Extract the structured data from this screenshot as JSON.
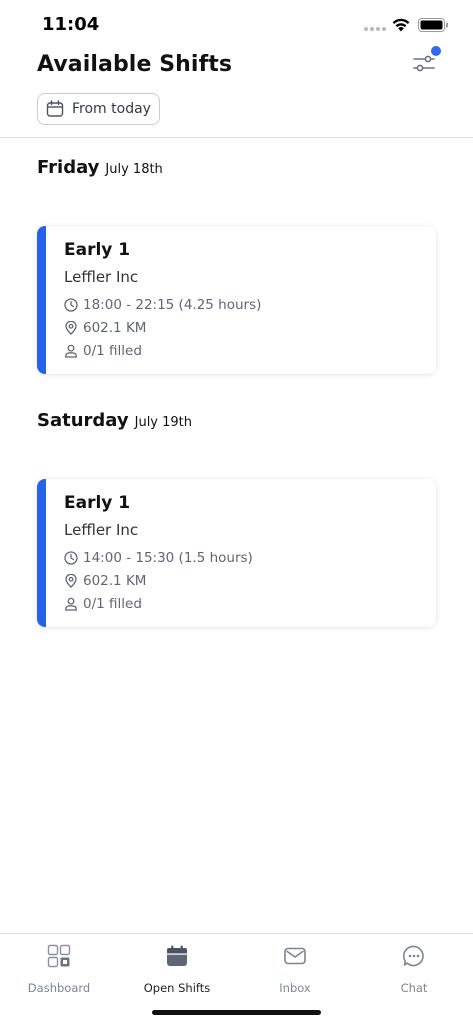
{
  "status_bar": {
    "time": "11:04"
  },
  "header": {
    "title": "Available Shifts",
    "date_filter_label": "From today"
  },
  "days": [
    {
      "day_name": "Friday",
      "date": "July 18th",
      "shifts": [
        {
          "title": "Early 1",
          "company": "Leffler Inc",
          "time": "18:00 - 22:15 (4.25 hours)",
          "distance": "602.1 KM",
          "filled": "0/1 filled"
        }
      ]
    },
    {
      "day_name": "Saturday",
      "date": "July 19th",
      "shifts": [
        {
          "title": "Early 1",
          "company": "Leffler Inc",
          "time": "14:00 - 15:30 (1.5 hours)",
          "distance": "602.1 KM",
          "filled": "0/1 filled"
        }
      ]
    }
  ],
  "tab_bar": {
    "active": "Open Shifts",
    "tabs": [
      {
        "label": "Dashboard",
        "icon": "dashboard-icon"
      },
      {
        "label": "Open Shifts",
        "icon": "calendar-icon"
      },
      {
        "label": "Inbox",
        "icon": "mail-icon"
      },
      {
        "label": "Chat",
        "icon": "chat-bubble-icon"
      }
    ]
  },
  "colors": {
    "accent": "#2663ea",
    "notification_dot": "#2f6be8",
    "muted_text": "#5f6673"
  }
}
